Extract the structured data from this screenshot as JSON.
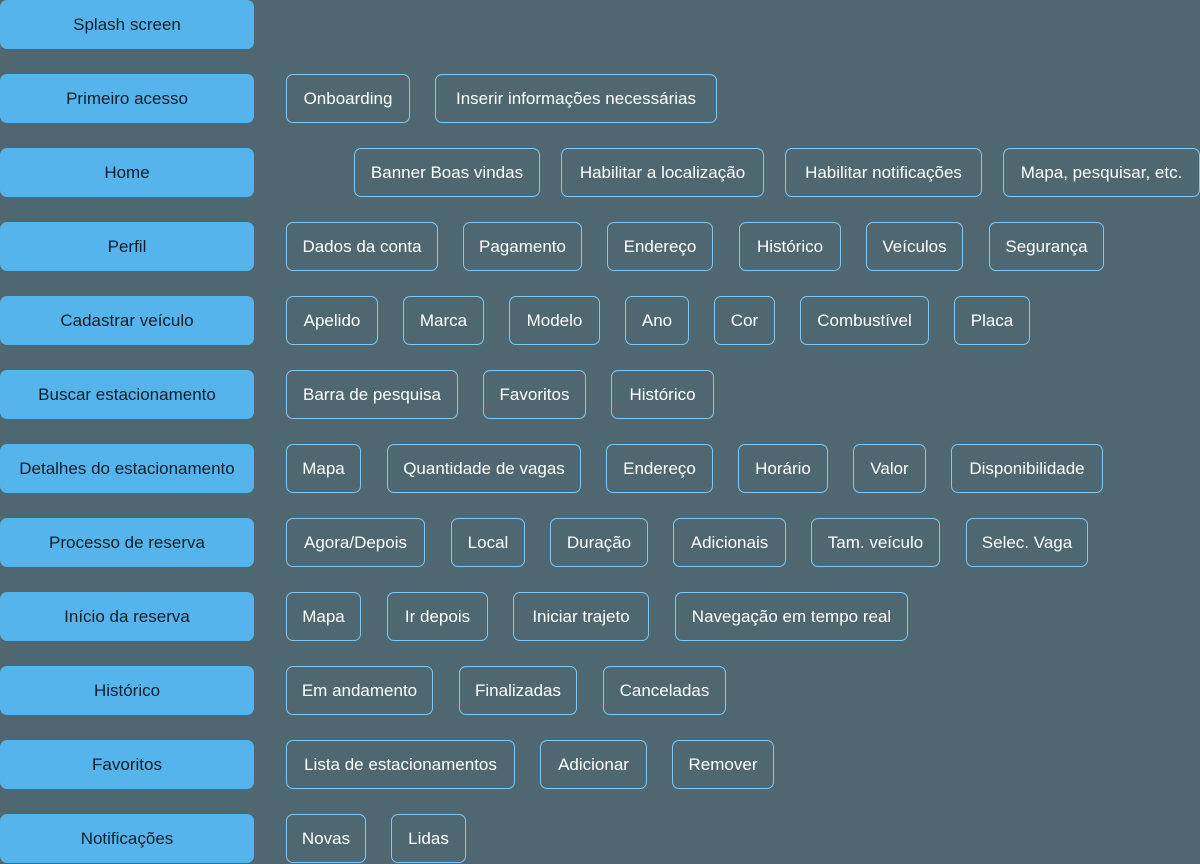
{
  "rows": [
    {
      "label": "Splash screen",
      "items": []
    },
    {
      "label": "Primeiro acesso",
      "items": [
        "Onboarding",
        "Inserir informações necessárias"
      ]
    },
    {
      "label": "Home",
      "items": [
        "Banner Boas vindas",
        "Habilitar a localização",
        "Habilitar notificações",
        "Mapa, pesquisar, etc."
      ]
    },
    {
      "label": "Perfil",
      "items": [
        "Dados da conta",
        "Pagamento",
        "Endereço",
        "Histórico",
        "Veículos",
        "Segurança"
      ]
    },
    {
      "label": "Cadastrar veículo",
      "items": [
        "Apelido",
        "Marca",
        "Modelo",
        "Ano",
        "Cor",
        "Combustível",
        "Placa"
      ]
    },
    {
      "label": "Buscar estacionamento",
      "items": [
        "Barra de pesquisa",
        "Favoritos",
        "Histórico"
      ]
    },
    {
      "label": "Detalhes do estacionamento",
      "items": [
        "Mapa",
        "Quantidade de vagas",
        "Endereço",
        "Horário",
        "Valor",
        "Disponibilidade"
      ]
    },
    {
      "label": "Processo de reserva",
      "items": [
        "Agora/Depois",
        "Local",
        "Duração",
        "Adicionais",
        "Tam. veículo",
        "Selec. Vaga"
      ]
    },
    {
      "label": "Início da reserva",
      "items": [
        "Mapa",
        "Ir depois",
        "Iniciar trajeto",
        "Navegação em tempo real"
      ]
    },
    {
      "label": "Histórico",
      "items": [
        "Em andamento",
        "Finalizadas",
        "Canceladas"
      ]
    },
    {
      "label": "Favoritos",
      "items": [
        "Lista de estacionamentos",
        "Adicionar",
        "Remover"
      ]
    },
    {
      "label": "Notificações",
      "items": [
        "Novas",
        "Lidas"
      ]
    }
  ],
  "colors": {
    "background": "#4e6770",
    "label_fill": "#56b4ec",
    "chip_border": "#7fc8f3",
    "chip_text": "#ffffff"
  }
}
